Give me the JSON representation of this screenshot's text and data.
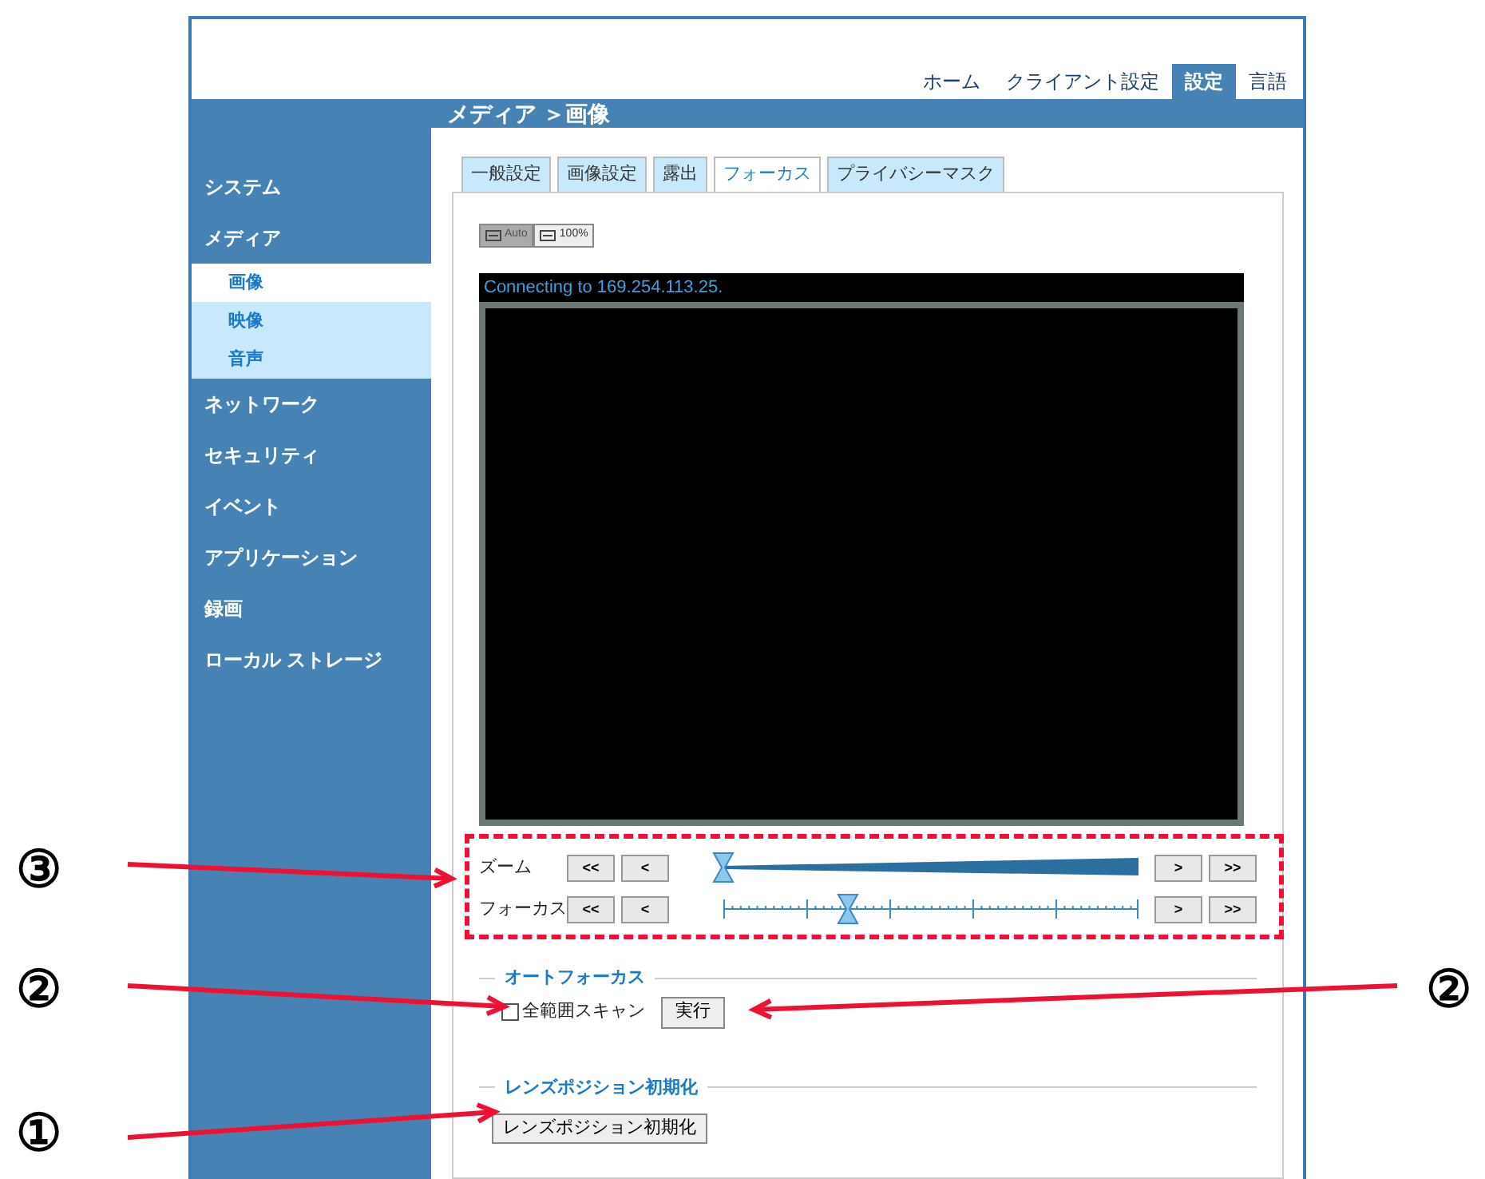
{
  "top_nav": [
    {
      "label": "ホーム",
      "selected": false
    },
    {
      "label": "クライアント設定",
      "selected": false
    },
    {
      "label": "設定",
      "selected": true
    },
    {
      "label": "言語",
      "selected": false
    }
  ],
  "breadcrumb": "メディア ＞画像",
  "sidebar": {
    "items": [
      {
        "label": "システム"
      },
      {
        "label": "メディア",
        "children": [
          {
            "label": "画像",
            "selected": true
          },
          {
            "label": "映像",
            "selected": false
          },
          {
            "label": "音声",
            "selected": false
          }
        ]
      },
      {
        "label": "ネットワーク"
      },
      {
        "label": "セキュリティ"
      },
      {
        "label": "イベント"
      },
      {
        "label": "アプリケーション"
      },
      {
        "label": "録画"
      },
      {
        "label": "ローカル ストレージ"
      }
    ]
  },
  "tabs": [
    {
      "label": "一般設定",
      "selected": false
    },
    {
      "label": "画像設定",
      "selected": false
    },
    {
      "label": "露出",
      "selected": false
    },
    {
      "label": "フォーカス",
      "selected": true
    },
    {
      "label": "プライバシーマスク",
      "selected": false
    }
  ],
  "view_buttons": [
    {
      "label": "Auto",
      "selected": true
    },
    {
      "label": "100%",
      "selected": false
    }
  ],
  "video": {
    "status": "Connecting to 169.254.113.25."
  },
  "sliders": [
    {
      "label": "ズーム",
      "kind": "wedge",
      "level": 0,
      "buttons": [
        "<<",
        "<",
        ">",
        ">>"
      ]
    },
    {
      "label": "フォーカス",
      "kind": "ticks",
      "level": 0.3,
      "buttons": [
        "<<",
        "<",
        ">",
        ">>"
      ]
    }
  ],
  "autofocus": {
    "title": "オートフォーカス",
    "checkbox": {
      "label": "全範囲スキャン",
      "checked": false
    },
    "button": "実行"
  },
  "lens_reset": {
    "title": "レンズポジション初期化",
    "button": "レンズポジション初期化"
  },
  "annotations": [
    {
      "label": "③"
    },
    {
      "label": "②"
    },
    {
      "label": "②"
    },
    {
      "label": "①"
    }
  ]
}
